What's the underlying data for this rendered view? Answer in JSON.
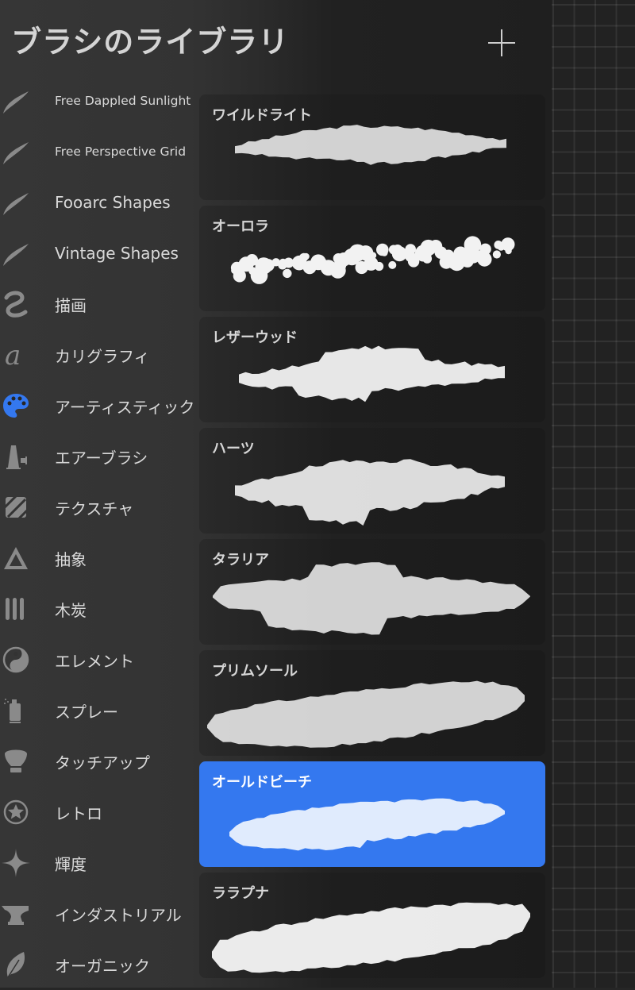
{
  "header": {
    "title": "ブラシのライブラリ",
    "add_button_icon": "plus-icon"
  },
  "brush_sets": [
    {
      "label": "Free Dappled Sunlight",
      "icon": "brush-stroke-icon",
      "small": true
    },
    {
      "label": "Free Perspective Grid",
      "icon": "brush-stroke-icon",
      "small": true
    },
    {
      "label": "Fooarc Shapes",
      "icon": "brush-stroke-icon"
    },
    {
      "label": "Vintage Shapes",
      "icon": "brush-stroke-icon"
    },
    {
      "label": "描画",
      "icon": "squiggle-icon"
    },
    {
      "label": "カリグラフィ",
      "icon": "calligraphy-a-icon"
    },
    {
      "label": "アーティスティック",
      "icon": "palette-icon",
      "active": true
    },
    {
      "label": "エアーブラシ",
      "icon": "airbrush-icon"
    },
    {
      "label": "テクスチャ",
      "icon": "texture-icon"
    },
    {
      "label": "抽象",
      "icon": "triangle-icon"
    },
    {
      "label": "木炭",
      "icon": "charcoal-icon"
    },
    {
      "label": "エレメント",
      "icon": "yin-yang-icon"
    },
    {
      "label": "スプレー",
      "icon": "spray-can-icon"
    },
    {
      "label": "タッチアップ",
      "icon": "makeup-brush-icon"
    },
    {
      "label": "レトロ",
      "icon": "star-circle-icon"
    },
    {
      "label": "輝度",
      "icon": "sparkle-icon"
    },
    {
      "label": "インダストリアル",
      "icon": "anvil-icon"
    },
    {
      "label": "オーガニック",
      "icon": "leaf-icon"
    }
  ],
  "brushes": [
    {
      "name": "ワイルドライト",
      "stroke": "wildlight"
    },
    {
      "name": "オーロラ",
      "stroke": "aurora"
    },
    {
      "name": "レザーウッド",
      "stroke": "leatherwood"
    },
    {
      "name": "ハーツ",
      "stroke": "hearts"
    },
    {
      "name": "タラリア",
      "stroke": "talaria"
    },
    {
      "name": "プリムソール",
      "stroke": "plimsoll"
    },
    {
      "name": "オールドビーチ",
      "stroke": "oldbeach",
      "selected": true
    },
    {
      "name": "ララプナ",
      "stroke": "larapuna"
    }
  ],
  "colors": {
    "accent": "#3478ef",
    "active_icon": "#3478ef",
    "icon": "#8a8a8a",
    "text": "#d9d9d9"
  }
}
